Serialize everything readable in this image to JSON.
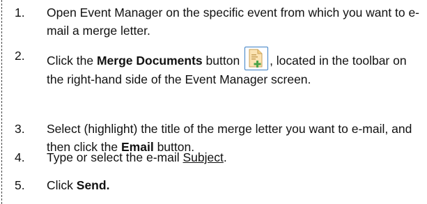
{
  "steps": [
    {
      "number": "1.",
      "text": "Open Event Manager on the specific event from which you want to e-mail a merge letter."
    },
    {
      "number": "2.",
      "text_before": "Click the ",
      "bold": "Merge Documents",
      "text_after_bold": " button ",
      "icon": "merge-documents-icon",
      "text_after_icon": ", located in the toolbar on the right-hand side of the Event Manager screen."
    },
    {
      "number": "3.",
      "text_before": "Select (highlight) the title of the merge letter you want to e-mail, and then click the ",
      "bold": "Email",
      "text_after": " button."
    },
    {
      "number": "4.",
      "text_before": "Type or select the e-mail ",
      "underlined": "Subject",
      "text_after": "."
    },
    {
      "number": "5.",
      "text_before": "Click ",
      "bold": "Send."
    }
  ],
  "colors": {
    "text": "#111111",
    "icon_border": "#3b7fc4",
    "icon_doc_fill": "#fbe3b3",
    "icon_plus": "#4aa34a"
  }
}
